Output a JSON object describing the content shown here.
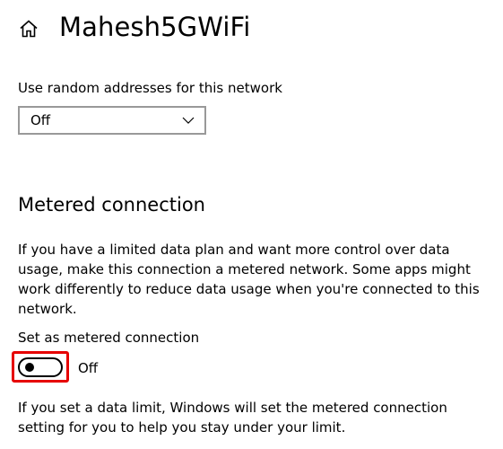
{
  "header": {
    "icon": "home-icon",
    "title": "Mahesh5GWiFi"
  },
  "random_addresses": {
    "label": "Use random addresses for this network",
    "selected": "Off"
  },
  "metered": {
    "section_title": "Metered connection",
    "description": "If you have a limited data plan and want more control over data usage, make this connection a metered network. Some apps might work differently to reduce data usage when you're connected to this network.",
    "toggle_label": "Set as metered connection",
    "toggle_state": "Off",
    "toggle_on": false,
    "highlight_color": "#e60000",
    "limit_text": "If you set a data limit, Windows will set the metered connection setting for you to help you stay under your limit."
  }
}
